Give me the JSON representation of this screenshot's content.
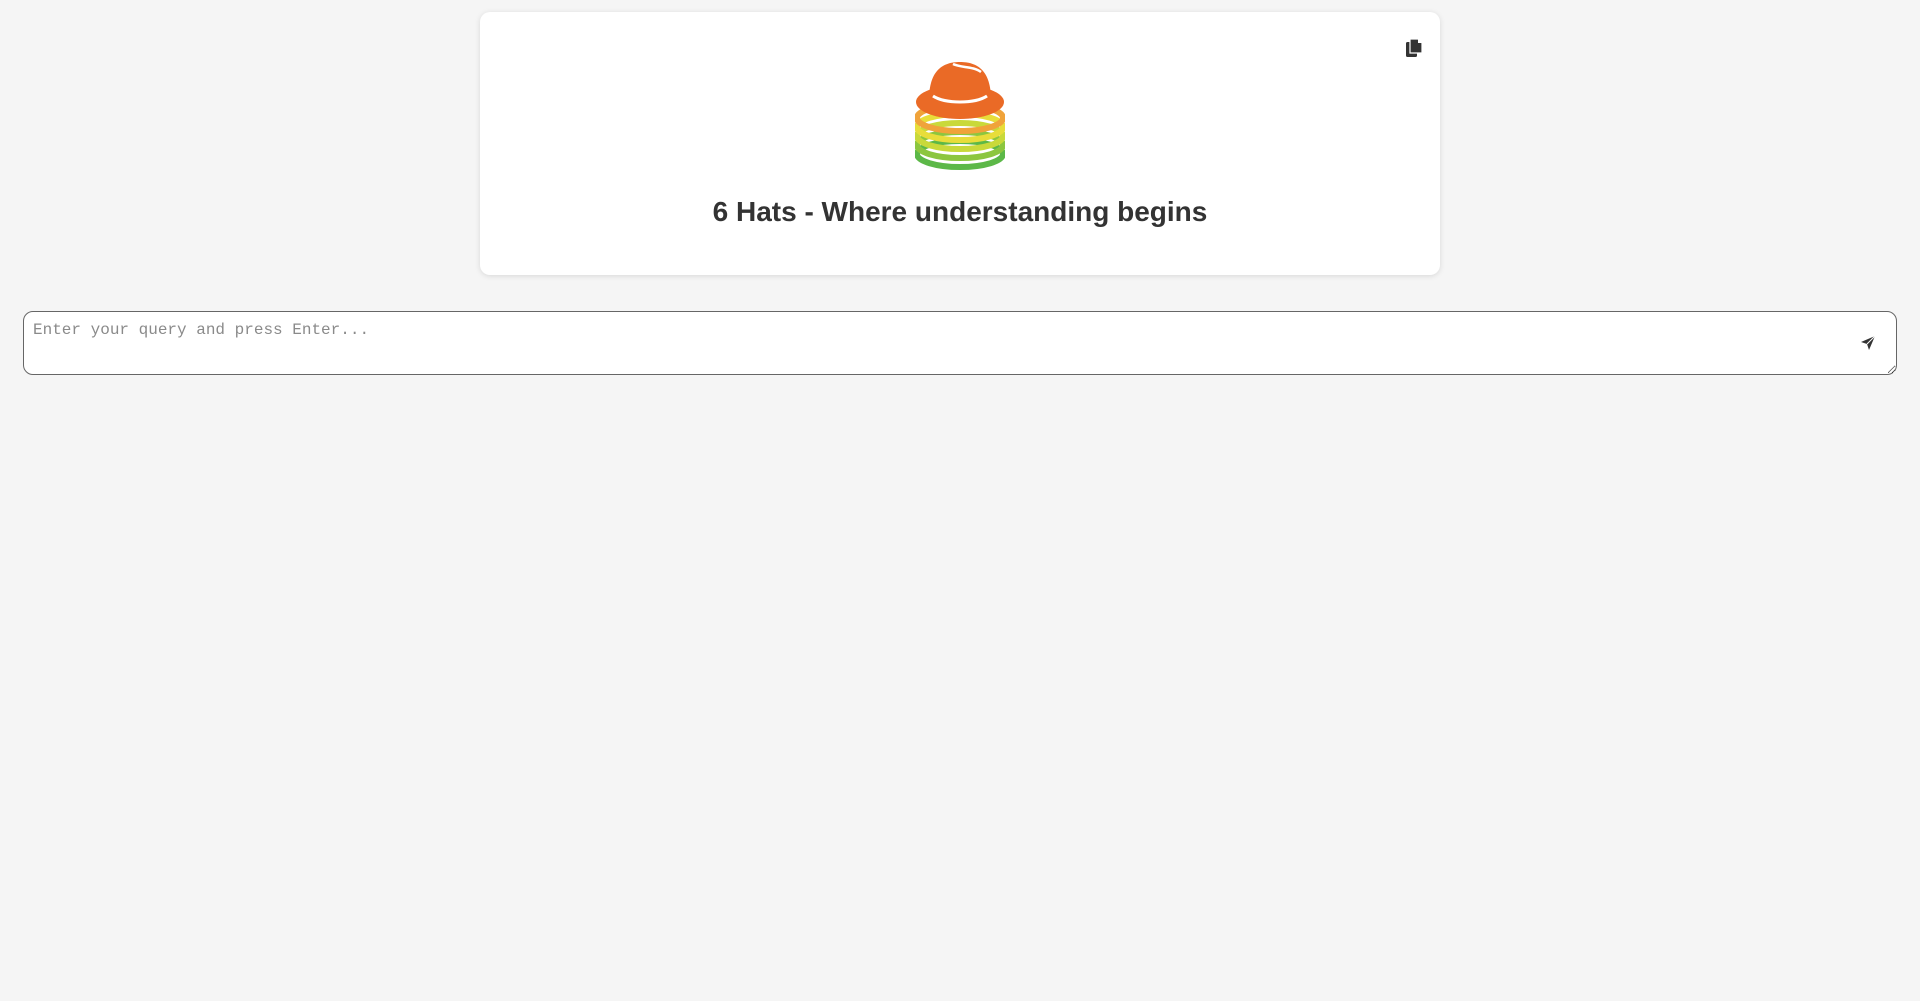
{
  "header": {
    "title": "6 Hats - Where understanding begins",
    "logo_icon": "hat-stack-logo",
    "copy_icon": "copy-icon",
    "logo_colors": {
      "hat": "#ea6a26",
      "band_orange": "#f0a33a",
      "band_yellow": "#e8dd3a",
      "band_lightgreen": "#b5d43a",
      "band_green": "#5cb848"
    }
  },
  "query": {
    "placeholder": "Enter your query and press Enter...",
    "value": "",
    "send_icon": "send-icon"
  }
}
